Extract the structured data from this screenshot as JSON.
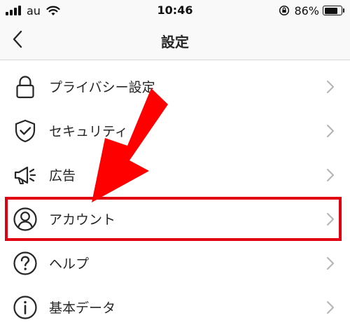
{
  "status_bar": {
    "carrier": "au",
    "time": "10:46",
    "battery_percent": "86%",
    "battery_level": 0.86,
    "icons": [
      "signal-icon",
      "wifi-icon",
      "orientation-lock-icon",
      "battery-icon"
    ]
  },
  "nav": {
    "title": "設定",
    "back_icon": "chevron-left-icon"
  },
  "settings": {
    "items": [
      {
        "label": "プライバシー設定",
        "icon": "lock-icon"
      },
      {
        "label": "セキュリティ",
        "icon": "shield-check-icon"
      },
      {
        "label": "広告",
        "icon": "megaphone-icon"
      },
      {
        "label": "アカウント",
        "icon": "user-circle-icon"
      },
      {
        "label": "ヘルプ",
        "icon": "help-circle-icon"
      },
      {
        "label": "基本データ",
        "icon": "info-circle-icon"
      }
    ]
  },
  "annotation": {
    "highlight_color": "#e00012",
    "arrow_color": "#ff0000"
  }
}
